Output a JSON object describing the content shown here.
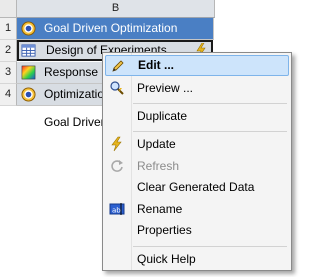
{
  "grid": {
    "column_header": "B",
    "rows": [
      {
        "num": "1",
        "label": "Goal Driven Optimization",
        "icon": "goal-driven-optimization-icon"
      },
      {
        "num": "2",
        "label": "Design of Experiments",
        "icon": "design-of-experiments-icon"
      },
      {
        "num": "3",
        "label": "Response Surface",
        "icon": "response-surface-icon"
      },
      {
        "num": "4",
        "label": "Optimization",
        "icon": "optimization-icon"
      }
    ],
    "footer_label": "Goal Driven Optimization"
  },
  "context_menu": {
    "items": [
      {
        "label": "Edit ...",
        "icon": "pencil-icon",
        "highlighted": true
      },
      {
        "label": "Preview ...",
        "icon": "preview-icon"
      },
      {
        "label": "Duplicate",
        "icon": ""
      },
      {
        "label": "Update",
        "icon": "lightning-icon"
      },
      {
        "label": "Refresh",
        "icon": "refresh-icon",
        "disabled": true
      },
      {
        "label": "Clear Generated Data",
        "icon": ""
      },
      {
        "label": "Rename",
        "icon": "rename-icon"
      },
      {
        "label": "Properties",
        "icon": ""
      },
      {
        "label": "Quick Help",
        "icon": ""
      }
    ]
  }
}
